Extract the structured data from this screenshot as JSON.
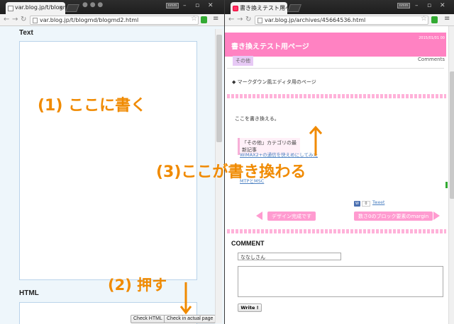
{
  "left_window": {
    "tab_title": "var.blog.jp/t/blogm",
    "url": "var.blog.jp/t/blogmd/blogmd2.html",
    "user_badge": "nmm",
    "text_label": "Text",
    "html_label": "HTML",
    "check_html_label": "Check HTML",
    "check_actual_label": "Check in actual page"
  },
  "right_window": {
    "tab_title": "書き換えテスト用ペ",
    "url": "var.blog.jp/archives/45664536.html",
    "user_badge": "nmm",
    "page_title": "書き換えテスト用ページ",
    "date": "2015/01/01 00",
    "category": "その他",
    "comments_link": "Comments",
    "entry_item": "◆ マークダウン風エディタ用のページ",
    "body_text": "ここを書き換える。",
    "recent_heading": "「その他」カテゴリの最新記事",
    "recent_links": [
      "WiMAX2+の通信を快えめにしてみた",
      "MTPとMSC"
    ],
    "like_label": "W",
    "like_count": "0",
    "tweet_label": "Tweet",
    "prev_link": "デザイン完成です",
    "next_link": "数さ0のブロック要素のmargin",
    "comment_heading": "COMMENT",
    "name_value": "ななしさん",
    "write_button": "Write !"
  },
  "annotations": {
    "step1": "(1) ここに書く",
    "step2": "(2) 押す",
    "step3": "(3)ここが書き換わる"
  },
  "colors": {
    "annotation": "#f08a00",
    "header_pink": "#ff82c2",
    "category_bg": "#e7c9f5"
  }
}
